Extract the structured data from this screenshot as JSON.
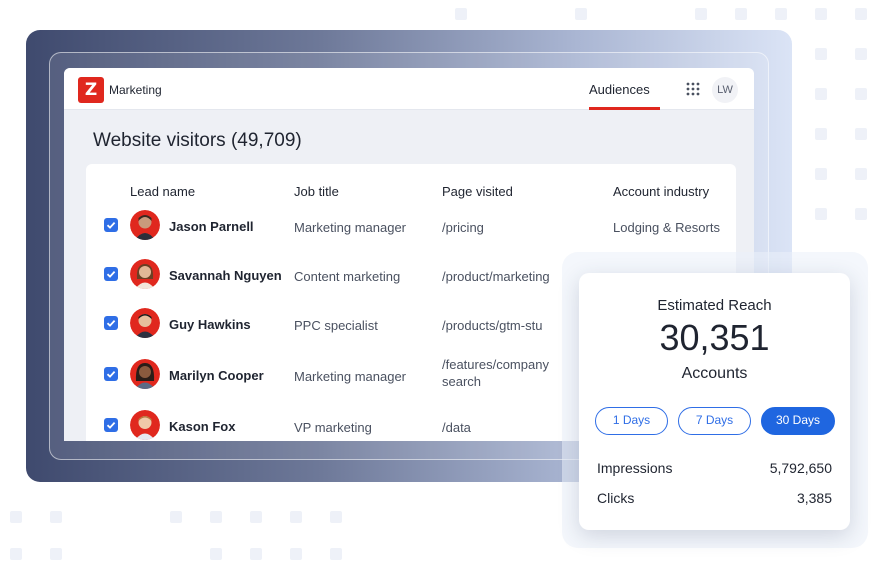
{
  "header": {
    "logo_letter": "Z",
    "app_name": "Marketing",
    "tab_active": "Audiences",
    "user_initials": "LW"
  },
  "page": {
    "title": "Website visitors (49,709)"
  },
  "table": {
    "columns": [
      "Lead name",
      "Job title",
      "Page visited",
      "Account industry"
    ],
    "rows": [
      {
        "name": "Jason Parnell",
        "job": "Marketing manager",
        "page": "/pricing",
        "industry": "Lodging & Resorts",
        "checked": true
      },
      {
        "name": "Savannah Nguyen",
        "job": "Content marketing",
        "page": "/product/marketing",
        "industry": "",
        "checked": true
      },
      {
        "name": "Guy Hawkins",
        "job": "PPC specialist",
        "page": "/products/gtm-stu",
        "industry": "",
        "checked": true
      },
      {
        "name": "Marilyn Cooper",
        "job": "Marketing manager",
        "page": "/features/company search",
        "industry": "",
        "checked": true
      },
      {
        "name": "Kason Fox",
        "job": "VP marketing",
        "page": "/data",
        "industry": "",
        "checked": true
      }
    ]
  },
  "reach": {
    "title": "Estimated Reach",
    "value": "30,351",
    "unit": "Accounts",
    "ranges": [
      "1 Days",
      "7 Days",
      "30 Days"
    ],
    "active_range": "30 Days",
    "metrics": [
      {
        "label": "Impressions",
        "value": "5,792,650"
      },
      {
        "label": "Clicks",
        "value": "3,385"
      }
    ]
  },
  "colors": {
    "brand_red": "#e0281e",
    "accent_blue": "#1f66e0"
  }
}
